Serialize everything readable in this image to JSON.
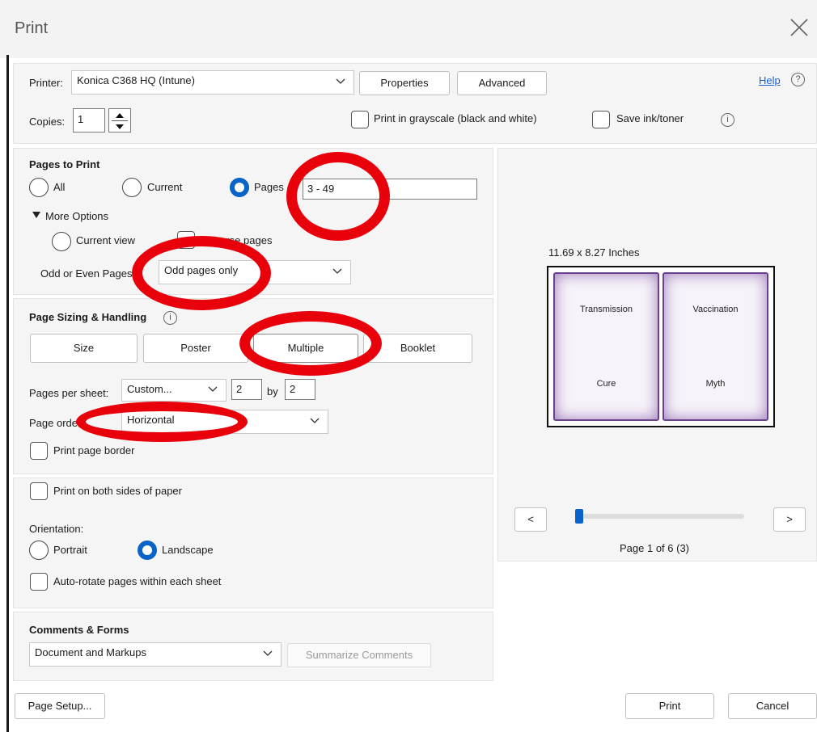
{
  "dialog": {
    "title": "Print"
  },
  "printer": {
    "label": "Printer:",
    "value": "Konica C368 HQ (Intune)",
    "properties_label": "Properties",
    "advanced_label": "Advanced",
    "help_label": "Help"
  },
  "copies": {
    "label": "Copies:",
    "value": "1",
    "grayscale_label": "Print in grayscale (black and white)",
    "save_ink_label": "Save ink/toner"
  },
  "pages_to_print": {
    "heading": "Pages to Print",
    "all_label": "All",
    "current_label": "Current",
    "pages_label": "Pages",
    "pages_value": "3 - 49",
    "more_options_label": "More Options",
    "current_view_label": "Current view",
    "reverse_label": "Reverse pages",
    "odd_even_label": "Odd or Even Pages:",
    "odd_even_value": "Odd pages only"
  },
  "page_sizing": {
    "heading": "Page Sizing & Handling",
    "tabs": [
      "Size",
      "Poster",
      "Multiple",
      "Booklet"
    ],
    "selected_tab": "Multiple",
    "pages_per_sheet_label": "Pages per sheet:",
    "pages_per_sheet_value": "Custom...",
    "cols": "2",
    "by_label": "by",
    "rows": "2",
    "page_order_label": "Page order:",
    "page_order_value": "Horizontal",
    "print_border_label": "Print page border"
  },
  "duplex": {
    "both_sides_label": "Print on both sides of paper",
    "orientation_label": "Orientation:",
    "portrait_label": "Portrait",
    "landscape_label": "Landscape",
    "orientation_selected": "Landscape",
    "auto_rotate_label": "Auto-rotate pages within each sheet"
  },
  "comments": {
    "heading": "Comments & Forms",
    "value": "Document and Markups",
    "summarize_label": "Summarize Comments"
  },
  "preview": {
    "size_label": "11.69 x 8.27 Inches",
    "tiles": [
      "Transmission",
      "Vaccination",
      "Cure",
      "Myth"
    ],
    "prev_label": "<",
    "next_label": ">",
    "page_status": "Page 1 of 6 (3)",
    "slider_fraction": 0.0
  },
  "footer": {
    "page_setup_label": "Page Setup...",
    "print_label": "Print",
    "cancel_label": "Cancel"
  },
  "colors": {
    "accent": "#0a64c8",
    "annotation": "#e8000b",
    "tile_border": "#6a3f8f"
  }
}
